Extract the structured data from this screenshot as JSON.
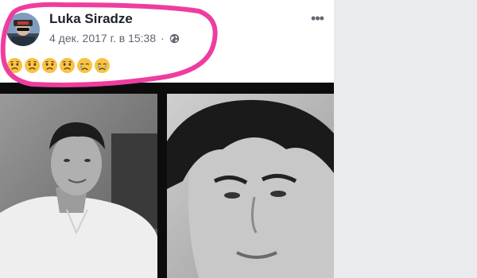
{
  "post": {
    "author_name": "Luka Siradze",
    "timestamp": "4 дек. 2017 г. в 15:38",
    "privacy_icon": "globe-icon",
    "more_options_label": "•••",
    "text_emojis": [
      "worried-face",
      "worried-face",
      "worried-face",
      "worried-face",
      "crying-face",
      "crying-face"
    ],
    "photo_count": 2
  },
  "annotation": {
    "highlight_color": "#ee3da0"
  },
  "colors": {
    "name": "#1d2129",
    "meta": "#606770",
    "page_background": "#e9ebee",
    "emoji_yellow": "#f7c443",
    "tear_blue": "#5aa7e6"
  }
}
